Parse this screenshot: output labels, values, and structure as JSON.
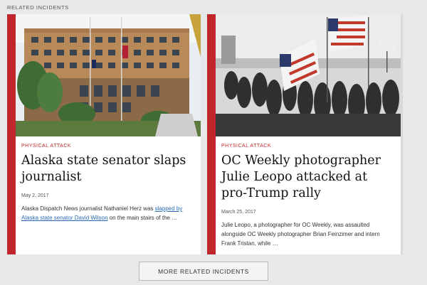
{
  "section": {
    "heading": "RELATED INCIDENTS"
  },
  "cards": [
    {
      "category": "PHYSICAL ATTACK",
      "headline": "Alaska state senator slaps journalist",
      "date": "May 2, 2017",
      "excerpt": {
        "before_link_1": "Alaska Dispatch News journalist Nathaniel Herz was ",
        "link_1": "slapped by Alaska state senator David Wilson",
        "after_link_1": " on the main stairs of the …"
      },
      "image_icon": "government-building-photo"
    },
    {
      "category": "PHYSICAL ATTACK",
      "headline": "OC Weekly photographer Julie Leopo attacked at pro-Trump rally",
      "date": "March 25, 2017",
      "excerpt": "Julie Leopo, a photographer for OC Weekly, was assaulted alongside OC Weekly photographer Brian Feinzimer and intern Frank Tristan, while …",
      "image_icon": "rally-with-flags-photo"
    }
  ],
  "more_button": {
    "label": "MORE RELATED INCIDENTS"
  },
  "colors": {
    "accent": "#c1262c",
    "link": "#2a6ab5",
    "page_bg": "#e7e8ea"
  }
}
